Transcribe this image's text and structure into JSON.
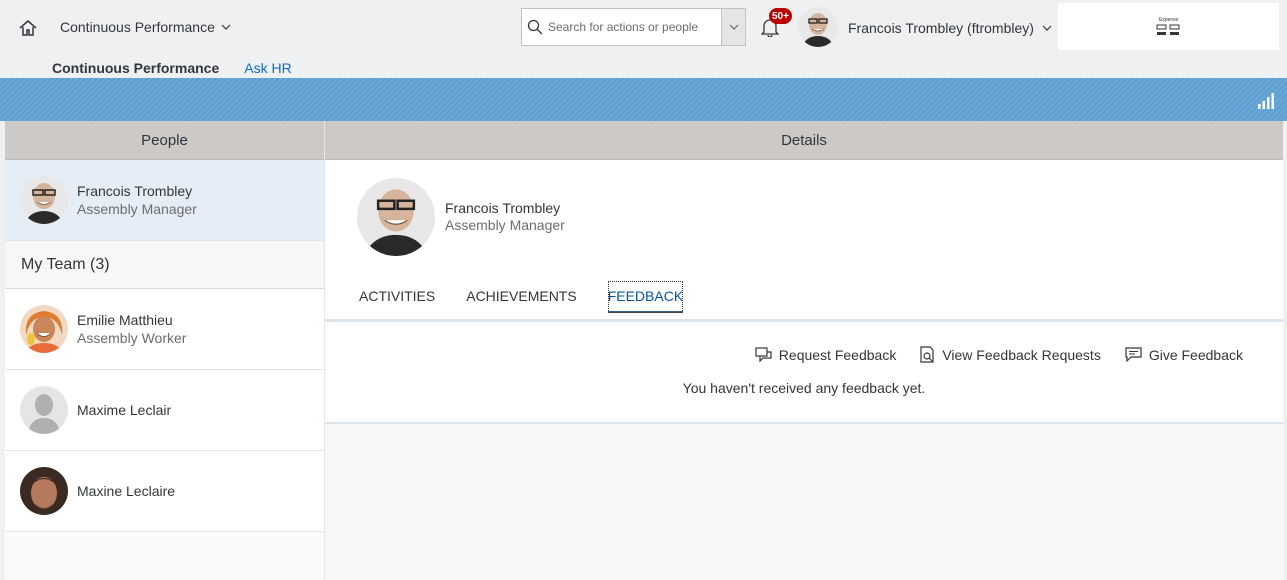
{
  "header": {
    "app_title": "Continuous Performance",
    "search_placeholder": "Search for actions or people",
    "notification_count": "50+",
    "user_display": "Francois Trombley (ftrombley)",
    "logo_text": "Expense"
  },
  "subnav": {
    "selected": "Continuous Performance",
    "link": "Ask HR"
  },
  "people_panel": {
    "title": "People",
    "self": {
      "name": "Francois Trombley",
      "role": "Assembly Manager"
    },
    "team_heading": "My Team (3)",
    "team": [
      {
        "name": "Emilie Matthieu",
        "role": "Assembly Worker"
      },
      {
        "name": "Maxime Leclair",
        "role": ""
      },
      {
        "name": "Maxine Leclaire",
        "role": ""
      }
    ]
  },
  "details_panel": {
    "title": "Details",
    "name": "Francois Trombley",
    "role": "Assembly Manager",
    "tabs": [
      "ACTIVITIES",
      "ACHIEVEMENTS",
      "FEEDBACK"
    ],
    "active_tab": "FEEDBACK",
    "actions": {
      "request": "Request Feedback",
      "view": "View Feedback Requests",
      "give": "Give Feedback"
    },
    "empty_message": "You haven't received any feedback yet."
  },
  "colors": {
    "accent": "#0a6ed1",
    "banner": "#5f9fd0",
    "badge": "#bb0000",
    "panel_header": "#cdc9c7"
  }
}
